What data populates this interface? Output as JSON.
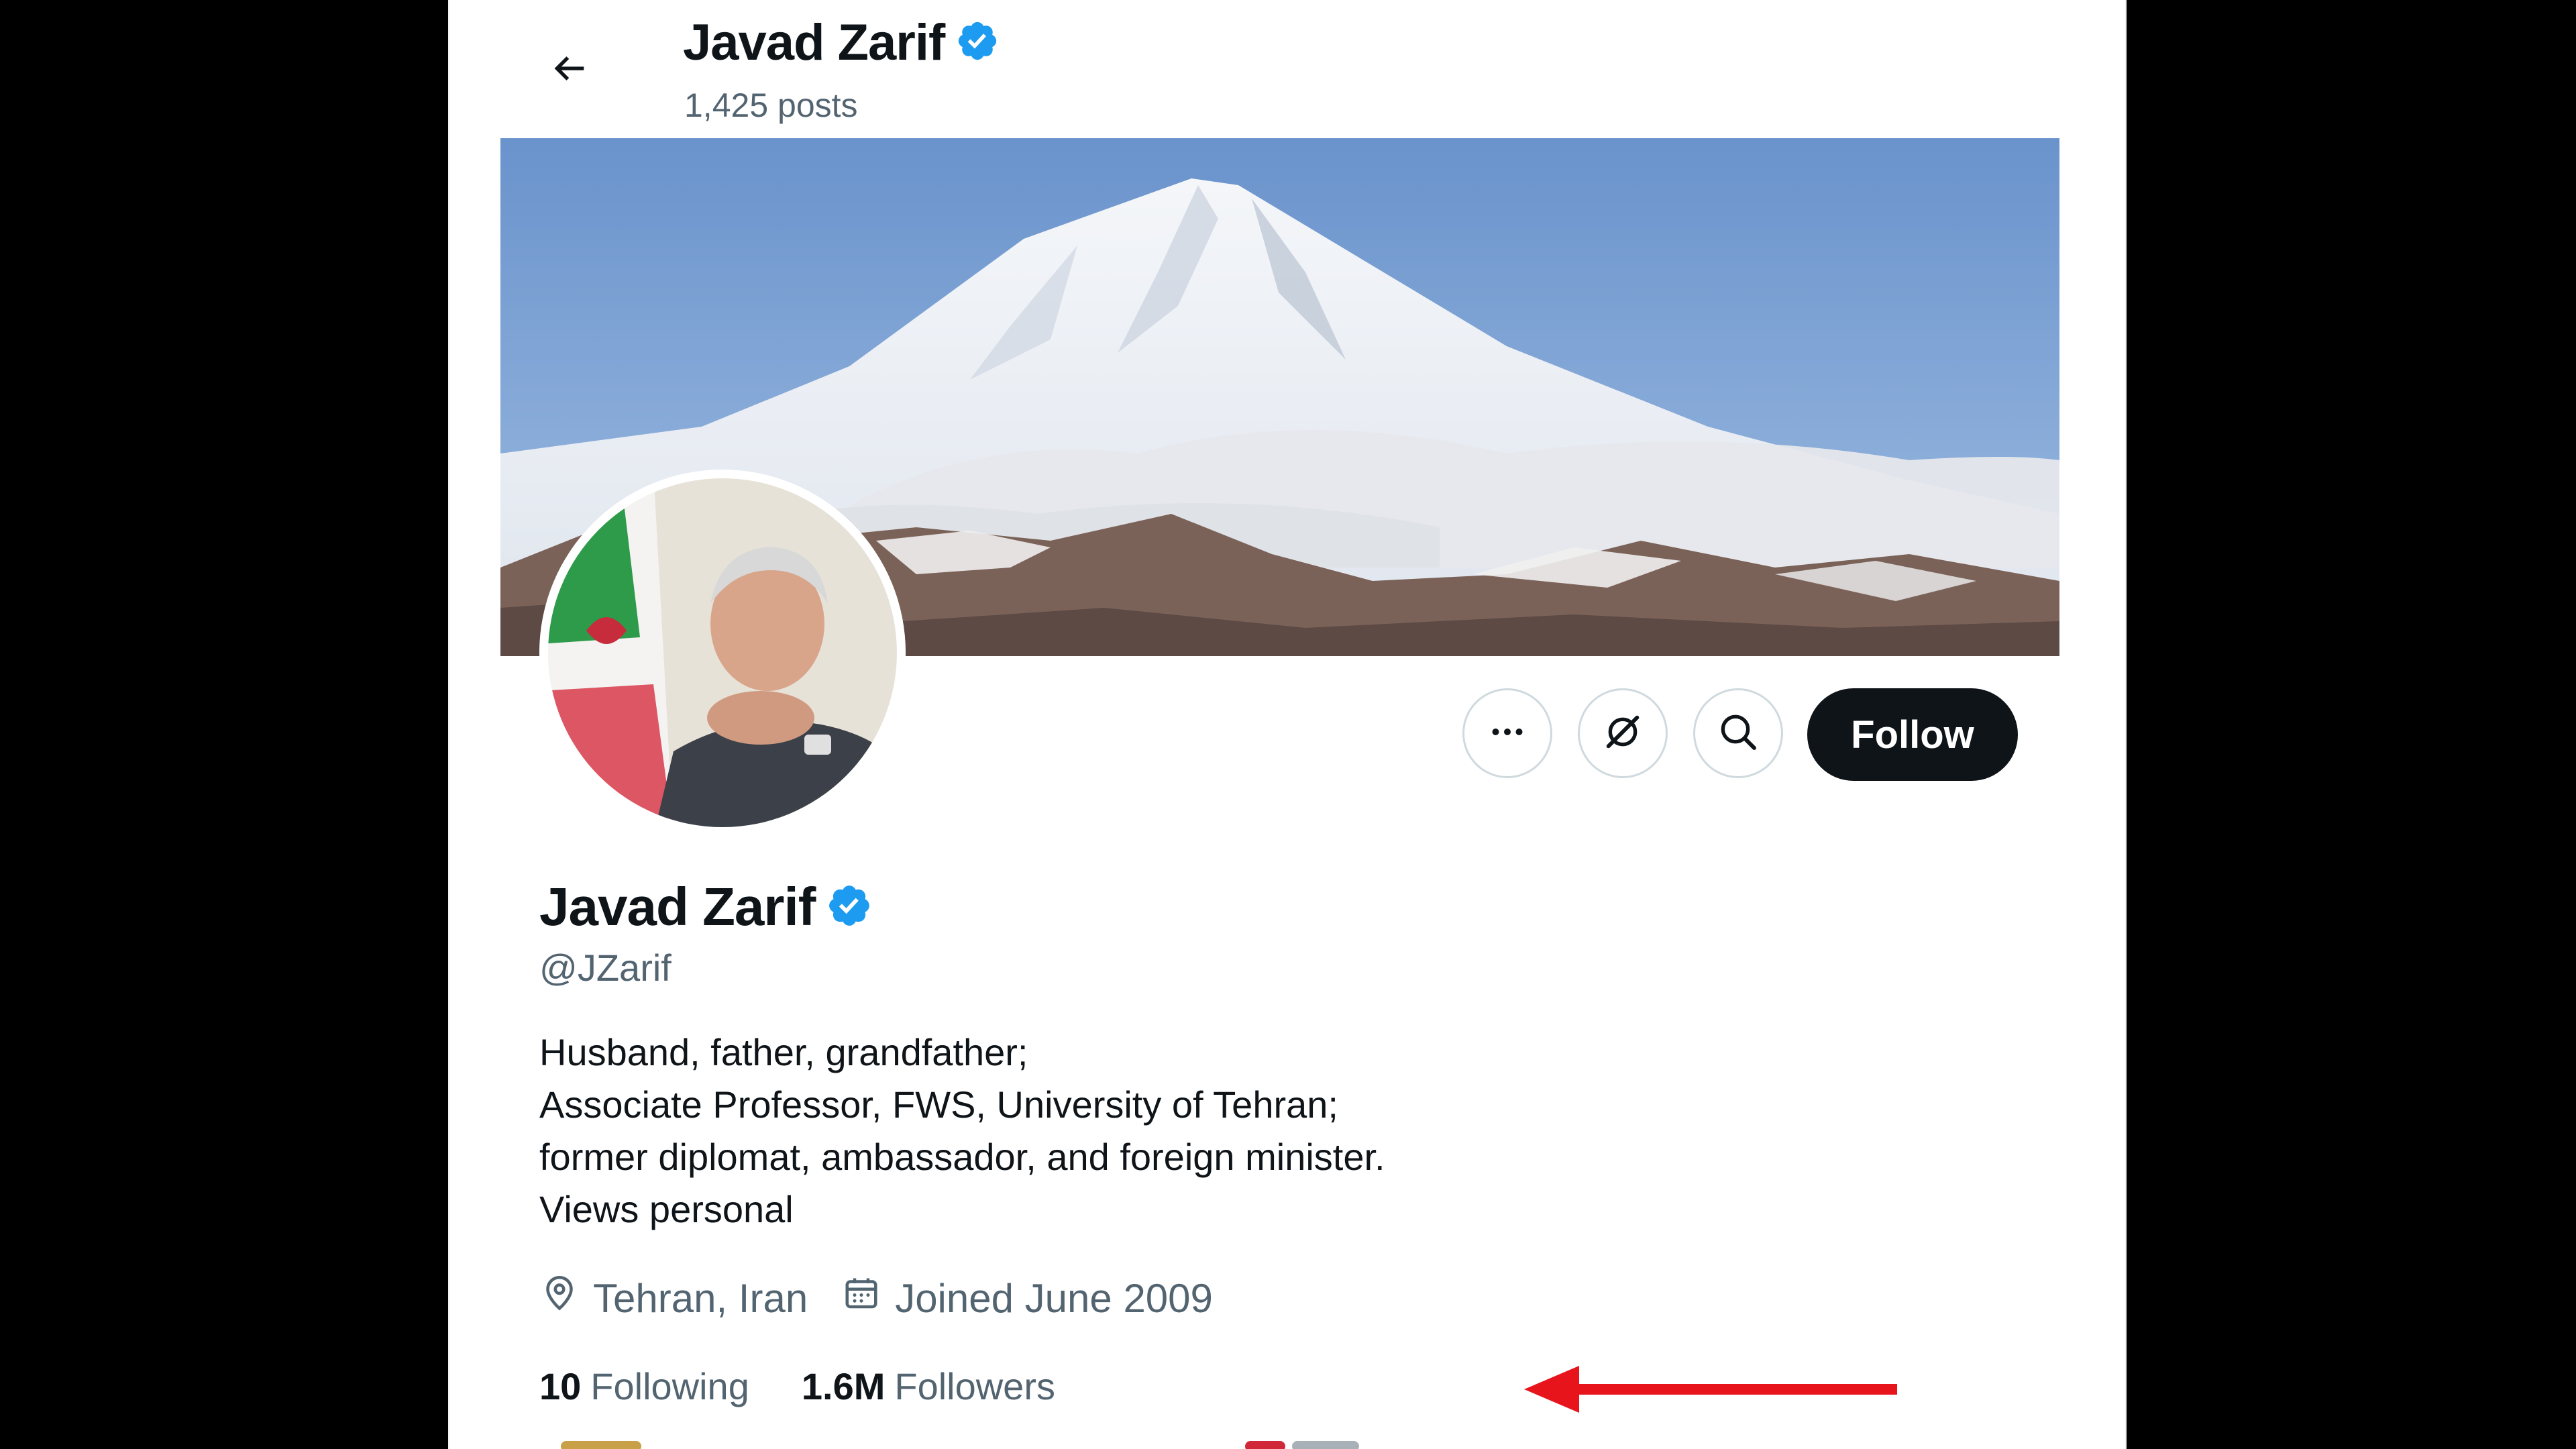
{
  "header": {
    "name": "Javad Zarif",
    "posts": "1,425 posts"
  },
  "profile": {
    "name": "Javad Zarif",
    "handle": "@JZarif",
    "bio": [
      "Husband, father, grandfather;",
      "Associate Professor, FWS, University of Tehran;",
      "former diplomat, ambassador, and foreign minister.",
      "Views personal"
    ],
    "location": "Tehran, Iran",
    "joined": "Joined June 2009",
    "following_count": "10",
    "following_label": "Following",
    "followers_count": "1.6M",
    "followers_label": "Followers"
  },
  "actions": {
    "follow_label": "Follow"
  },
  "icons": {
    "back": "back-arrow-icon",
    "verified": "verified-badge-icon",
    "more": "more-icon",
    "grok": "grok-icon",
    "search": "search-icon",
    "location": "location-pin-icon",
    "calendar": "calendar-icon"
  },
  "colors": {
    "verified_blue": "#1d9bf0",
    "follow_button": "#0f1419",
    "secondary_text": "#536471",
    "annotation_arrow": "#e8141c"
  }
}
